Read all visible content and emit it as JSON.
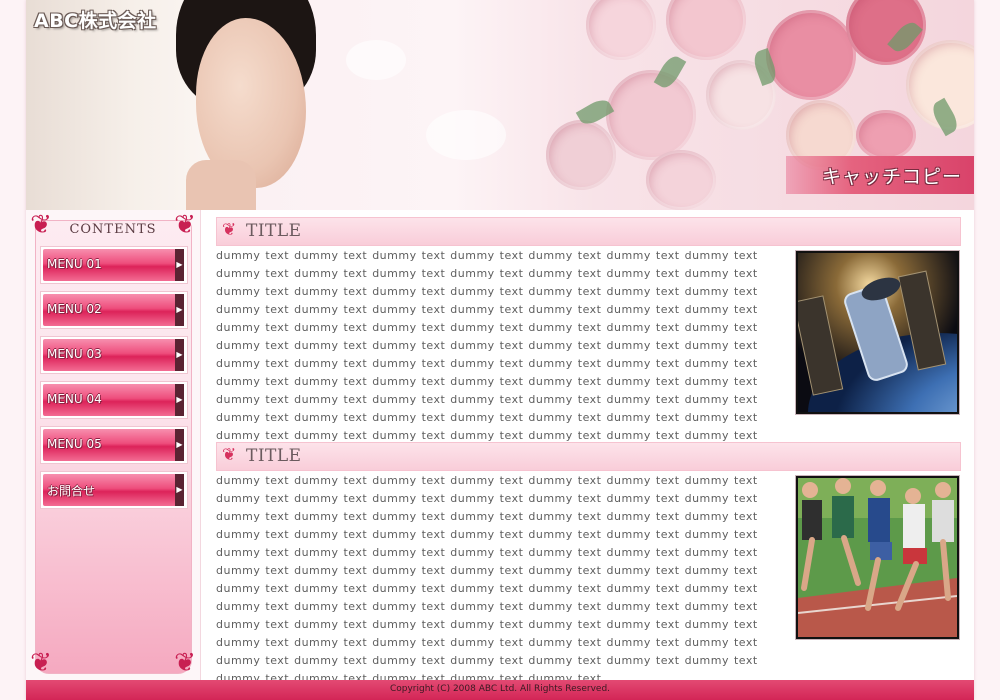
{
  "header": {
    "company": "ABC株式会社",
    "catch_copy": "キャッチコピー"
  },
  "sidebar": {
    "title": "CONTENTS",
    "menu": [
      {
        "label": "MENU 01"
      },
      {
        "label": "MENU 02"
      },
      {
        "label": "MENU 03"
      },
      {
        "label": "MENU 04"
      },
      {
        "label": "MENU 05"
      },
      {
        "label": "お問合せ"
      }
    ]
  },
  "main": {
    "sections": [
      {
        "title": "TITLE",
        "text": "dummy text dummy text dummy text dummy text dummy text dummy text dummy text dummy text dummy text dummy text dummy text dummy text dummy text dummy text dummy text dummy text dummy text dummy text dummy text dummy text dummy text dummy text dummy text dummy text dummy text dummy text dummy text dummy text dummy text dummy text dummy text dummy text dummy text dummy text dummy text dummy text dummy text dummy text dummy text dummy text dummy text dummy text dummy text dummy text dummy text dummy text dummy text dummy text dummy text dummy text dummy text dummy text dummy text dummy text dummy text dummy text dummy text dummy text dummy text dummy text dummy text dummy text dummy text dummy text dummy text dummy text dummy text dummy text dummy text dummy text dummy text dummy text dummy text dummy text dummy text dummy text dummy text dummy text dummy text dummy text dummy text",
        "image": "space-telescope-photo"
      },
      {
        "title": "TITLE",
        "text": "dummy text dummy text dummy text dummy text dummy text dummy text dummy text dummy text dummy text dummy text dummy text dummy text dummy text dummy text dummy text dummy text dummy text dummy text dummy text dummy text dummy text dummy text dummy text dummy text dummy text dummy text dummy text dummy text dummy text dummy text dummy text dummy text dummy text dummy text dummy text dummy text dummy text dummy text dummy text dummy text dummy text dummy text dummy text dummy text dummy text dummy text dummy text dummy text dummy text dummy text dummy text dummy text dummy text dummy text dummy text dummy text dummy text dummy text dummy text dummy text dummy text dummy text dummy text dummy text dummy text dummy text dummy text dummy text dummy text dummy text dummy text dummy text dummy text dummy text dummy text dummy text dummy text dummy text dummy text dummy text dummy text dummy text",
        "image": "runners-photo"
      }
    ]
  },
  "footer": {
    "copyright": "Copyright (C) 2008 ABC Ltd. All Rights Reserved."
  },
  "colors": {
    "accent": "#d9436a",
    "menu_button": "#ee4d7c",
    "title_bar": "#f9cdd9"
  }
}
